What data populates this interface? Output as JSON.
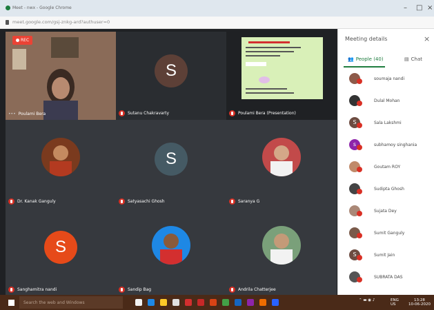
{
  "browser": {
    "title": "Meet - nwx - Google Chrome",
    "url": "meet.google.com/gsj-znkg-ard?authuser=0"
  },
  "recording_label": "REC",
  "tiles": [
    {
      "name": "Poulami Bera",
      "type": "video"
    },
    {
      "name": "Sutanu Chakravarty",
      "type": "avatar",
      "initial": "S",
      "color": "#5d4037"
    },
    {
      "name": "Poulami Bera (Presentation)",
      "type": "presentation"
    },
    {
      "name": "Dr. Kanak Ganguly",
      "type": "photo"
    },
    {
      "name": "Satyasachi Ghosh",
      "type": "avatar",
      "initial": "S",
      "color": "#455a64"
    },
    {
      "name": "Saranya G",
      "type": "photo"
    },
    {
      "name": "Sanghamitra nandi",
      "type": "avatar",
      "initial": "S",
      "color": "#e64a19"
    },
    {
      "name": "Sandip Bag",
      "type": "photo"
    },
    {
      "name": "Andrila Chatterjee",
      "type": "photo"
    }
  ],
  "panel": {
    "title": "Meeting details",
    "close_icon": "close-icon",
    "tab_people": "People (40)",
    "tab_chat": "Chat",
    "participants": [
      {
        "name": "soumaja nandi",
        "initial": "",
        "color": "#8d5a4a"
      },
      {
        "name": "Dulal Mohan",
        "initial": "",
        "color": "#333333"
      },
      {
        "name": "Sala Lakshmi",
        "initial": "S",
        "color": "#6d4c41"
      },
      {
        "name": "subhamoy singhania",
        "initial": "s",
        "color": "#8e24aa"
      },
      {
        "name": "Goutam ROY",
        "initial": "",
        "color": "#c08a6a"
      },
      {
        "name": "Sudipta Ghosh",
        "initial": "",
        "color": "#444444"
      },
      {
        "name": "Sujata Dey",
        "initial": "",
        "color": "#aa8877"
      },
      {
        "name": "Sumit Ganguly",
        "initial": "",
        "color": "#7a5a4a"
      },
      {
        "name": "Sumit Jain",
        "initial": "S",
        "color": "#6d4c41"
      },
      {
        "name": "SUBRATA DAS",
        "initial": "",
        "color": "#555555"
      }
    ]
  },
  "taskbar": {
    "search_placeholder": "Search the web and Windows",
    "lang": "ENG",
    "region": "US",
    "time": "13:28",
    "date": "10-06-2020"
  }
}
